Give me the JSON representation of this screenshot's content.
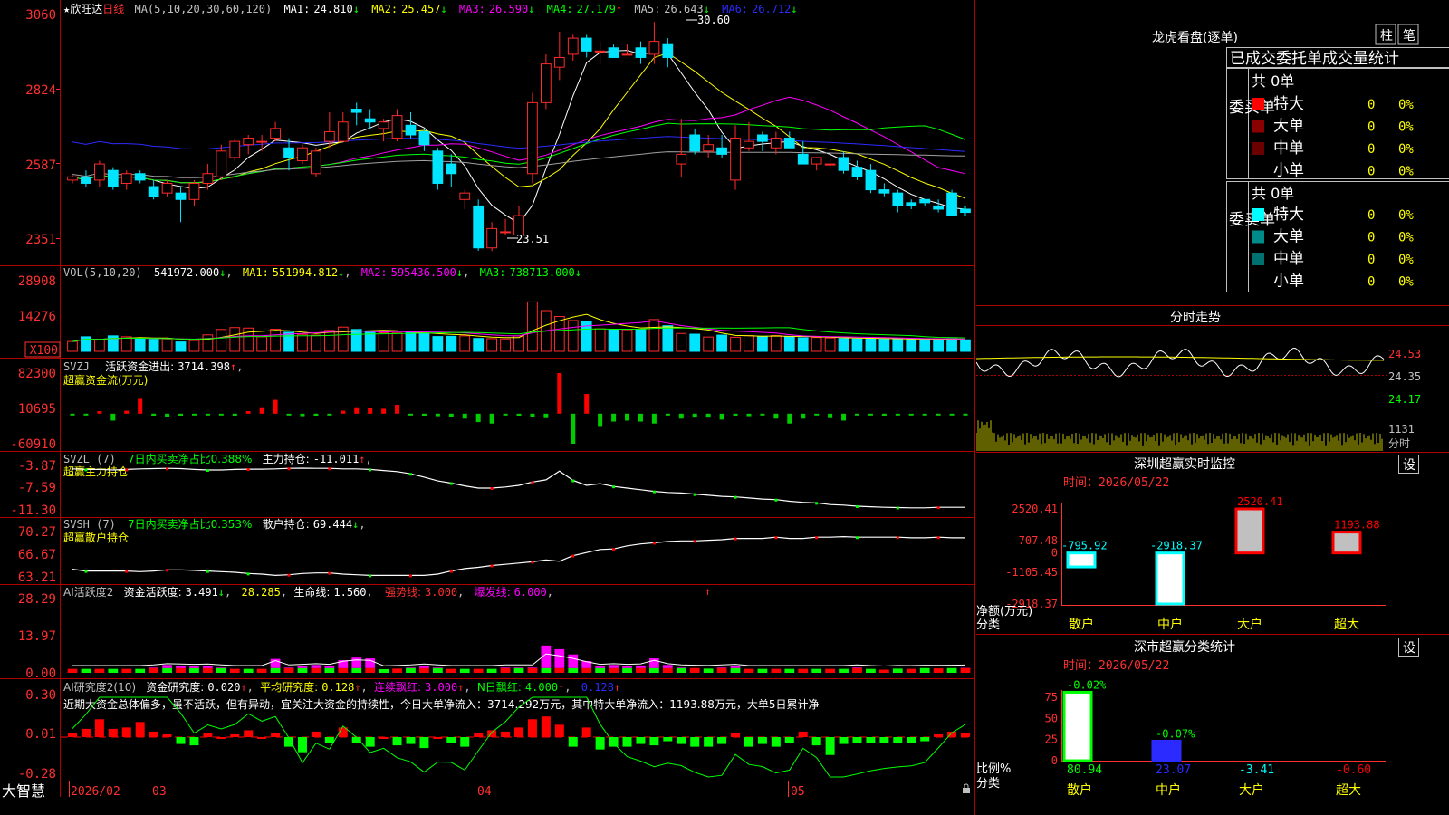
{
  "colors": {
    "up": "#ff2a2a",
    "down": "#00e5ff",
    "grid": "#8b0000",
    "axis": "#ff3030",
    "white": "#ffffff",
    "yellow": "#ffff00",
    "magenta": "#ff00ff",
    "green": "#00ff00",
    "blue": "#2b2bff",
    "grey": "#a0a0a0",
    "cyan": "#00ffff"
  },
  "main": {
    "star": "★",
    "name": "欣旺达",
    "period": "日线",
    "ma_title": "MA(5,10,20,30,60,120)",
    "ma": [
      {
        "label": "MA1:",
        "value": "24.810",
        "dir": "↓"
      },
      {
        "label": "MA2:",
        "value": "25.457",
        "dir": "↓"
      },
      {
        "label": "MA3:",
        "value": "26.590",
        "dir": "↓"
      },
      {
        "label": "MA4:",
        "value": "27.179",
        "dir": "↑"
      },
      {
        "label": "MA5:",
        "value": "26.643",
        "dir": "↓"
      },
      {
        "label": "MA6:",
        "value": "26.712",
        "dir": "↓"
      }
    ],
    "yticks": [
      "3060",
      "2824",
      "2587",
      "2351"
    ],
    "high_label": "30.60",
    "low_label": "23.51"
  },
  "vol": {
    "title": "VOL(5,10,20)",
    "value": "541972.000",
    "dir": "↓",
    "ma": [
      {
        "label": "MA1:",
        "value": "551994.812",
        "dir": "↓"
      },
      {
        "label": "MA2:",
        "value": "595436.500",
        "dir": "↓"
      },
      {
        "label": "MA3:",
        "value": "738713.000",
        "dir": "↓"
      }
    ],
    "yticks": [
      "28908",
      "14276",
      "X100"
    ]
  },
  "svzj": {
    "title": "SVZJ",
    "label": "活跃资金进出:",
    "value": "3714.398",
    "dir": "↑",
    "subtitle": "超赢资金流(万元)",
    "yticks": [
      "82300",
      "10695",
      "-60910"
    ]
  },
  "svzl": {
    "title": "SVZL (7)",
    "pct_label": "7日内买卖净占比0.388%",
    "hold_label": "主力持仓:",
    "hold_value": "-11.011",
    "dir": "↑",
    "subtitle": "超赢主力持仓",
    "yticks": [
      "-3.87",
      "-7.59",
      "-11.30"
    ]
  },
  "svsh": {
    "title": "SVSH (7)",
    "pct_label": "7日内买卖净占比0.353%",
    "hold_label": "散户持仓:",
    "hold_value": "69.444",
    "dir": "↓",
    "subtitle": "超赢散户持仓",
    "yticks": [
      "70.27",
      "66.67",
      "63.21"
    ]
  },
  "ai1": {
    "title": "AI活跃度2",
    "l1": "资金活跃度:",
    "v1": "3.491",
    "d1": "↓",
    "v2": "28.285",
    "l3": "生命线:",
    "v3": "1.560",
    "l4": "强势线:",
    "v4": "3.000",
    "l5": "爆发线:",
    "v5": "6.000",
    "yticks": [
      "28.29",
      "13.97",
      "0.00"
    ]
  },
  "ai2": {
    "title": "AI研究度2(10)",
    "l1": "资金研究度:",
    "v1": "0.020",
    "d1": "↑",
    "l2": "平均研究度:",
    "v2": "0.128",
    "d2": "↑",
    "l3": "连续飘红:",
    "v3": "3.000",
    "d3": "↑",
    "l4": "N日飘红:",
    "v4": "4.000",
    "d4": "↑",
    "v5": "0.128",
    "d5": "↑",
    "comment": "近期大资金总体偏多，虽不活跃，但有异动，宜关注大资金的持续性，今日大单净流入：3714.292万元，其中特大单净流入：1193.88万元，大单5日累计净",
    "yticks": [
      "0.30",
      "0.01",
      "-0.28"
    ]
  },
  "bottom": {
    "brand": "大智慧",
    "start": "2026/02",
    "months": [
      "03",
      "04",
      "05"
    ]
  },
  "right": {
    "lhb_title": "龙虎看盘(逐单)",
    "btn1": "柱",
    "btn2": "笔",
    "tabs_title": "已成交委托单成交量统计",
    "buy_label": "委买单",
    "sell_label": "委卖单",
    "buy_total": "共 0单",
    "sell_total": "共 0单",
    "buy_rows": [
      {
        "name": "特大",
        "value": "0",
        "pct": "0%",
        "color": "#ff0000"
      },
      {
        "name": "大单",
        "value": "0",
        "pct": "0%",
        "color": "#8b0000"
      },
      {
        "name": "中单",
        "value": "0",
        "pct": "0%",
        "color": "#6b0000"
      },
      {
        "name": "小单",
        "value": "0",
        "pct": "0%",
        "color": "#000000"
      }
    ],
    "sell_rows": [
      {
        "name": "特大",
        "value": "0",
        "pct": "0%",
        "color": "#00ffff"
      },
      {
        "name": "大单",
        "value": "0",
        "pct": "0%",
        "color": "#008b8b"
      },
      {
        "name": "中单",
        "value": "0",
        "pct": "0%",
        "color": "#007070"
      },
      {
        "name": "小单",
        "value": "0",
        "pct": "0%",
        "color": "#000000"
      }
    ],
    "fs_title": "分时走势",
    "fs_prices": [
      "24.53",
      "24.35",
      "24.17"
    ],
    "fs_vol": "1131",
    "fs_label": "分时",
    "sz_title": "深圳超赢实时监控",
    "set1": "设",
    "sz_time_label": "时间：",
    "sz_time": "2026/05/22",
    "sz_yticks": [
      "2520.41",
      "707.48",
      "0",
      "-1105.45",
      "-2918.37"
    ],
    "sz_ylabel": "净额(万元)",
    "sz_xlabel": "分类",
    "sz_cats": [
      "散户",
      "中户",
      "大户",
      "超大"
    ],
    "sz_values": [
      -795.92,
      -2918.37,
      2520.41,
      1193.88
    ],
    "sz_value_labels": [
      "-795.92",
      "-2918.37",
      "2520.41",
      "1193.88"
    ],
    "ss_title": "深市超赢分类统计",
    "set2": "设",
    "ss_time_label": "时间：",
    "ss_time": "2026/05/22",
    "ss_yticks": [
      "75",
      "50",
      "25",
      "0"
    ],
    "ss_ylabel": "比例%",
    "ss_xlabel": "分类",
    "ss_cats": [
      "散户",
      "中户",
      "大户",
      "超大"
    ],
    "ss_top_labels": [
      "-0.02%",
      "-0.07%"
    ],
    "ss_bottom_values": [
      "80.94",
      "23.07",
      "-3.41",
      "-0.60"
    ]
  },
  "chart_data": [
    {
      "type": "candlestick",
      "name": "欣旺达 日线",
      "ohlc": [
        [
          25.7,
          25.9,
          25.6,
          25.8
        ],
        [
          25.8,
          26.0,
          25.5,
          25.6
        ],
        [
          25.7,
          26.3,
          25.5,
          26.2
        ],
        [
          26.0,
          26.1,
          25.4,
          25.5
        ],
        [
          25.6,
          26.0,
          25.4,
          25.9
        ],
        [
          25.9,
          26.0,
          25.6,
          25.7
        ],
        [
          25.5,
          25.7,
          25.1,
          25.2
        ],
        [
          25.3,
          25.7,
          25.2,
          25.6
        ],
        [
          25.3,
          25.5,
          24.4,
          25.1
        ],
        [
          25.1,
          25.7,
          24.9,
          25.6
        ],
        [
          25.6,
          26.2,
          25.4,
          25.9
        ],
        [
          25.8,
          26.8,
          25.7,
          26.6
        ],
        [
          26.4,
          27.0,
          26.3,
          26.9
        ],
        [
          26.8,
          27.1,
          26.5,
          27.0
        ],
        [
          26.9,
          27.1,
          26.6,
          26.9
        ],
        [
          27.0,
          27.5,
          26.9,
          27.3
        ],
        [
          26.7,
          27.0,
          26.0,
          26.4
        ],
        [
          26.3,
          26.8,
          26.2,
          26.7
        ],
        [
          25.9,
          26.7,
          25.8,
          26.6
        ],
        [
          26.9,
          27.8,
          26.7,
          27.2
        ],
        [
          26.9,
          27.8,
          26.9,
          27.5
        ],
        [
          27.9,
          28.1,
          27.4,
          27.8
        ],
        [
          27.6,
          27.9,
          27.3,
          27.5
        ],
        [
          27.3,
          27.6,
          26.9,
          27.5
        ],
        [
          27.0,
          27.9,
          26.9,
          27.7
        ],
        [
          27.4,
          27.8,
          27.0,
          27.1
        ],
        [
          27.2,
          27.3,
          26.6,
          26.8
        ],
        [
          26.6,
          26.7,
          25.4,
          25.6
        ],
        [
          26.2,
          26.5,
          25.5,
          25.9
        ],
        [
          25.1,
          25.4,
          24.8,
          25.3
        ],
        [
          24.9,
          25.1,
          23.51,
          23.6
        ],
        [
          23.6,
          24.4,
          23.5,
          24.2
        ],
        [
          24.1,
          24.5,
          24.0,
          24.1
        ],
        [
          24.0,
          24.9,
          24.0,
          24.6
        ],
        [
          25.9,
          28.4,
          25.6,
          28.1
        ],
        [
          28.1,
          29.6,
          27.9,
          29.3
        ],
        [
          29.2,
          30.3,
          28.8,
          29.5
        ],
        [
          29.6,
          30.2,
          29.4,
          30.1
        ],
        [
          30.1,
          30.2,
          29.5,
          29.7
        ],
        [
          29.7,
          30.0,
          29.3,
          29.7
        ],
        [
          29.8,
          29.9,
          29.5,
          29.5
        ],
        [
          29.6,
          29.9,
          29.6,
          29.6
        ],
        [
          29.8,
          30.0,
          29.3,
          29.5
        ],
        [
          29.6,
          30.6,
          29.3,
          30.0
        ],
        [
          29.9,
          30.1,
          29.2,
          29.5
        ],
        [
          26.2,
          27.6,
          25.8,
          26.5
        ],
        [
          27.1,
          27.3,
          26.5,
          26.6
        ],
        [
          26.6,
          27.1,
          26.4,
          26.8
        ],
        [
          26.7,
          27.1,
          26.4,
          26.5
        ],
        [
          25.7,
          27.4,
          25.4,
          27.0
        ],
        [
          26.7,
          27.5,
          26.6,
          26.9
        ],
        [
          27.1,
          27.2,
          26.6,
          26.9
        ],
        [
          26.7,
          27.2,
          26.5,
          27.0
        ],
        [
          27.0,
          27.2,
          26.7,
          26.7
        ],
        [
          26.5,
          26.9,
          26.2,
          26.2
        ],
        [
          26.2,
          26.4,
          26.0,
          26.4
        ],
        [
          26.2,
          26.4,
          26.0,
          26.2
        ],
        [
          26.4,
          26.6,
          25.9,
          26.0
        ],
        [
          26.1,
          26.3,
          25.7,
          25.8
        ],
        [
          26.0,
          26.2,
          25.3,
          25.4
        ],
        [
          25.4,
          25.6,
          25.2,
          25.3
        ],
        [
          25.3,
          25.4,
          24.7,
          24.9
        ],
        [
          25.0,
          25.1,
          24.8,
          24.9
        ],
        [
          25.1,
          25.1,
          24.9,
          25.0
        ],
        [
          24.9,
          25.1,
          24.7,
          24.8
        ],
        [
          25.3,
          25.4,
          24.6,
          24.6
        ],
        [
          24.8,
          24.9,
          24.6,
          24.7
        ]
      ],
      "ylim": [
        23.2,
        31.0
      ]
    },
    {
      "type": "bar",
      "name": "VOL",
      "values": [
        4200,
        6200,
        4800,
        6600,
        6200,
        5500,
        5100,
        4900,
        4000,
        4600,
        7000,
        9300,
        10100,
        9900,
        6200,
        9400,
        8100,
        7200,
        6900,
        8900,
        10300,
        9300,
        8300,
        7900,
        7800,
        8000,
        7700,
        6300,
        6400,
        6600,
        5500,
        5400,
        5300,
        6600,
        21000,
        17300,
        14800,
        13100,
        12500,
        9600,
        9400,
        9200,
        9200,
        13500,
        10900,
        7600,
        7300,
        6100,
        6900,
        6000,
        6700,
        6400,
        6700,
        6200,
        5800,
        5900,
        5700,
        5500,
        5300,
        5400,
        5400,
        5300,
        5100,
        5000,
        5200,
        5400,
        4900
      ],
      "ylim": [
        0,
        30000
      ]
    },
    {
      "type": "bar",
      "name": "SVZJ",
      "values": [
        -2000,
        -3000,
        5000,
        -14000,
        6000,
        30000,
        -4000,
        -7000,
        -4000,
        -3000,
        -3000,
        -3000,
        -4000,
        5000,
        13000,
        28000,
        -2000,
        -5000,
        -4000,
        -2000,
        6000,
        13000,
        12000,
        10000,
        18000,
        -2000,
        -4000,
        -5000,
        -7000,
        -10000,
        -17000,
        -20000,
        -3000,
        -4000,
        -6000,
        -9000,
        82300,
        -60910,
        40000,
        -25000,
        -16000,
        -14000,
        -16000,
        -20000,
        -3000,
        -10000,
        -8000,
        -8000,
        -12000,
        -4000,
        -5000,
        -3000,
        -10000,
        -20000,
        -10000,
        -3000,
        -9000,
        -14000,
        -3000,
        -3000,
        -4000,
        -2000,
        -3000,
        -2000,
        -2000,
        -3000,
        -2000
      ],
      "ylim": [
        -60910,
        82300
      ]
    },
    {
      "type": "line",
      "name": "SVZL",
      "values": [
        -4.0,
        -4.1,
        -4.1,
        -4.2,
        -4.1,
        -4.0,
        -3.95,
        -3.9,
        -3.95,
        -4.1,
        -4.2,
        -4.2,
        -4.1,
        -4.05,
        -4.05,
        -4.0,
        -3.9,
        -3.87,
        -3.9,
        -3.9,
        -4.0,
        -4.0,
        -4.1,
        -4.3,
        -4.5,
        -4.9,
        -5.5,
        -6.2,
        -6.6,
        -7.1,
        -7.5,
        -7.5,
        -7.3,
        -7.0,
        -6.4,
        -6.0,
        -4.4,
        -6.1,
        -7.0,
        -6.7,
        -7.2,
        -7.5,
        -7.8,
        -8.1,
        -8.3,
        -8.4,
        -8.6,
        -8.8,
        -9.0,
        -9.1,
        -9.3,
        -9.5,
        -9.6,
        -9.9,
        -10.1,
        -10.2,
        -10.5,
        -10.6,
        -10.8,
        -10.9,
        -11.0,
        -11.05,
        -11.1,
        -11.1,
        -11.0,
        -11.0,
        -11.0
      ],
      "ylim": [
        -11.3,
        -3.87
      ]
    },
    {
      "type": "line",
      "name": "SVSH",
      "values": [
        64.3,
        64.0,
        64.0,
        64.0,
        64.0,
        63.9,
        64.0,
        64.2,
        64.2,
        64.1,
        64.0,
        63.9,
        63.8,
        63.6,
        63.5,
        63.3,
        63.4,
        63.6,
        63.7,
        63.7,
        63.5,
        63.4,
        63.3,
        63.3,
        63.3,
        63.3,
        63.3,
        63.5,
        64.0,
        64.4,
        64.6,
        64.9,
        65.1,
        65.3,
        65.5,
        65.8,
        65.6,
        66.5,
        67.0,
        67.5,
        67.6,
        68.1,
        68.4,
        68.6,
        68.8,
        68.9,
        68.9,
        69.0,
        69.1,
        69.3,
        69.3,
        69.3,
        69.5,
        69.3,
        69.3,
        69.5,
        69.5,
        69.6,
        69.5,
        69.5,
        69.5,
        69.5,
        69.4,
        69.4,
        69.5,
        69.4,
        69.4
      ],
      "ylim": [
        63.21,
        70.27
      ]
    },
    {
      "type": "bar",
      "name": "AI活跃度2",
      "values": [
        1.5,
        1.5,
        1.5,
        1.5,
        1.5,
        1.5,
        2.0,
        3.0,
        2.7,
        2.5,
        2.7,
        2.0,
        1.5,
        1.5,
        1.5,
        5.3,
        2.0,
        2.5,
        3.0,
        2.5,
        4.8,
        5.8,
        5.5,
        1.4,
        1.6,
        2.0,
        2.7,
        2.0,
        1.5,
        1.5,
        1.5,
        1.5,
        2.0,
        2.0,
        2.0,
        10.4,
        9.0,
        7.0,
        4.5,
        2.5,
        3.0,
        2.5,
        2.8,
        5.5,
        3.0,
        2.0,
        1.8,
        1.6,
        2.0,
        2.5,
        1.5,
        1.5,
        1.5,
        1.5,
        1.5,
        1.5,
        1.5,
        1.5,
        2.0,
        1.5,
        1.2,
        1.6,
        1.5,
        1.8,
        1.7,
        1.8,
        1.9
      ],
      "ylim": [
        0,
        28.29
      ]
    },
    {
      "type": "bar",
      "name": "AI研究度2(10)",
      "values": [
        0.04,
        0.07,
        0.14,
        0.07,
        0.08,
        0.12,
        0.05,
        0.03,
        -0.04,
        -0.05,
        0.04,
        0.0,
        0.03,
        0.06,
        0.0,
        0.04,
        -0.06,
        -0.1,
        0.05,
        -0.03,
        0.08,
        -0.03,
        -0.06,
        0.0,
        -0.05,
        -0.04,
        -0.07,
        0.0,
        -0.03,
        -0.06,
        0.04,
        0.06,
        0.05,
        0.08,
        0.14,
        0.16,
        0.1,
        -0.06,
        0.08,
        -0.08,
        -0.06,
        -0.06,
        -0.04,
        -0.05,
        -0.02,
        -0.04,
        -0.06,
        -0.06,
        -0.04,
        0.04,
        -0.06,
        -0.04,
        -0.06,
        -0.03,
        0.05,
        -0.05,
        -0.12,
        -0.04,
        -0.03,
        -0.03,
        -0.03,
        -0.03,
        -0.03,
        -0.02,
        0.03,
        0.05,
        0.04
      ],
      "ylim": [
        -0.28,
        0.3
      ]
    }
  ]
}
